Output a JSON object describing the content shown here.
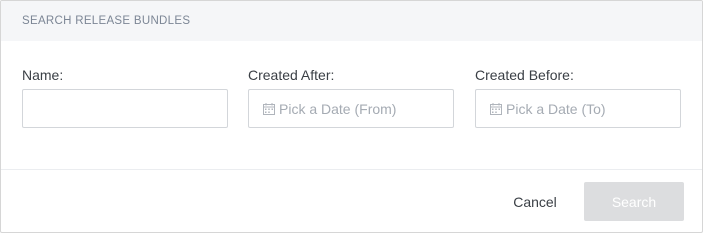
{
  "dialog": {
    "title": "SEARCH RELEASE BUNDLES"
  },
  "fields": {
    "name": {
      "label": "Name:",
      "value": "",
      "placeholder": ""
    },
    "created_after": {
      "label": "Created After:",
      "placeholder": "Pick a Date (From)",
      "icon": "calendar-icon"
    },
    "created_before": {
      "label": "Created Before:",
      "placeholder": "Pick a Date (To)",
      "icon": "calendar-icon"
    }
  },
  "footer": {
    "cancel_label": "Cancel",
    "search_label": "Search"
  },
  "colors": {
    "header_bg": "#f5f6f8",
    "search_button_disabled": "#dcdddf"
  }
}
